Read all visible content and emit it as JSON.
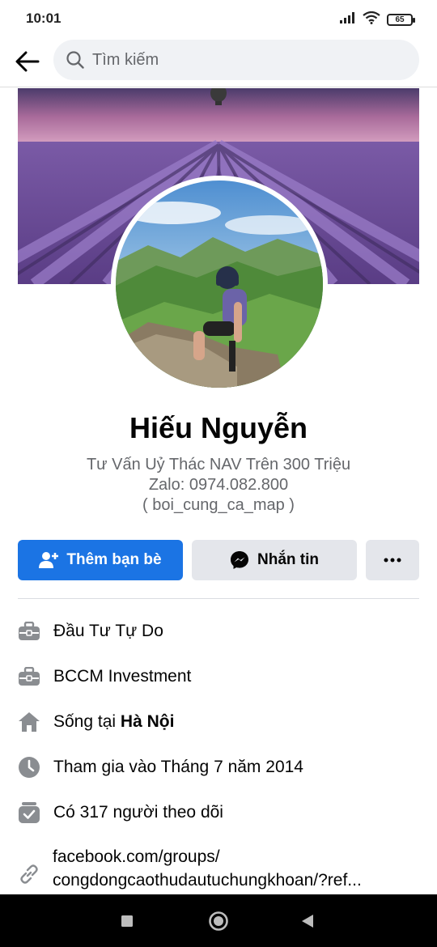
{
  "status_bar": {
    "time": "10:01",
    "battery": "65",
    "icons": [
      "signal-icon",
      "wifi-icon",
      "battery-icon"
    ]
  },
  "search": {
    "placeholder": "Tìm kiếm",
    "icons": [
      "back-arrow-icon",
      "search-icon"
    ]
  },
  "profile": {
    "name": "Hiếu Nguyễn",
    "bio": [
      "Tư Vấn Uỷ Thác NAV Trên 300 Triệu",
      "Zalo: 0974.082.800",
      "( boi_cung_ca_map )"
    ]
  },
  "actions": {
    "add_friend": "Thêm bạn bè",
    "message": "Nhắn tin",
    "more": "more-options"
  },
  "details": {
    "work1": "Đầu Tư Tự Do",
    "work2": "BCCM Investment",
    "lives_prefix": "Sống tại ",
    "lives_city": "Hà Nội",
    "joined": "Tham gia vào Tháng 7 năm 2014",
    "followers": "Có 317 người theo dõi",
    "link_line1": "facebook.com/groups/",
    "link_line2": "congdongcaothudautuchungkhoan/?ref..."
  },
  "nav": {
    "icons": [
      "square-recents-icon",
      "circle-home-icon",
      "triangle-back-icon"
    ]
  },
  "colors": {
    "primary": "#1b74e4",
    "secondary_button": "#e4e6eb",
    "muted_text": "#65676b",
    "icon_gray": "#8a8d91"
  }
}
